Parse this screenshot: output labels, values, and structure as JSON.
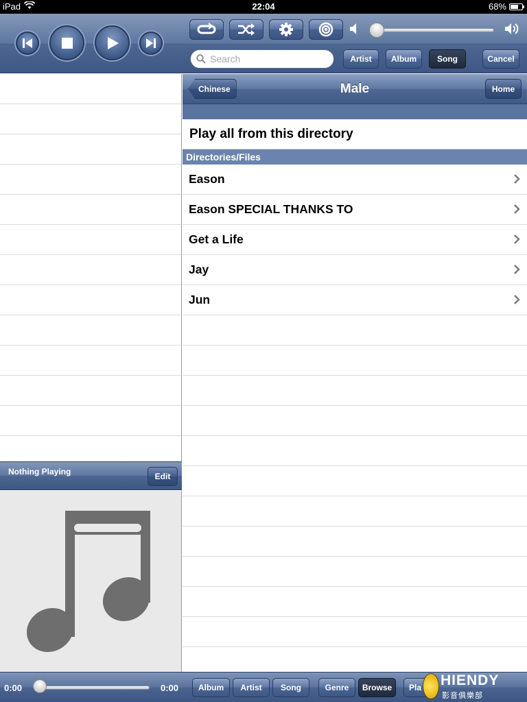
{
  "status_bar": {
    "device": "iPad",
    "time": "22:04",
    "battery": "68%",
    "battery_level": 0.68
  },
  "toolbar": {
    "volume_level": 0.02,
    "search_placeholder": "Search",
    "scopes": [
      {
        "label": "Artist",
        "selected": false
      },
      {
        "label": "Album",
        "selected": false
      },
      {
        "label": "Song",
        "selected": true
      }
    ],
    "cancel_label": "Cancel"
  },
  "left_pane": {
    "now_playing": "Nothing Playing",
    "edit_label": "Edit"
  },
  "browser": {
    "back_label": "Chinese",
    "title": "Male",
    "home_label": "Home",
    "play_all": "Play all from this directory",
    "section_header": "Directories/Files",
    "items": [
      "Eason",
      "Eason SPECIAL THANKS TO",
      "Get a Life",
      "Jay",
      "Jun"
    ]
  },
  "bottom_bar": {
    "elapsed": "0:00",
    "remaining": "0:00",
    "progress": 0,
    "tabs": [
      {
        "label": "Album",
        "selected": false
      },
      {
        "label": "Artist",
        "selected": false
      },
      {
        "label": "Song",
        "selected": false
      },
      {
        "label": "Genre",
        "selected": false
      },
      {
        "label": "Browse",
        "selected": true
      },
      {
        "label": "Pla",
        "selected": false
      }
    ]
  },
  "watermark": {
    "word": "HIENDY",
    "sub": "影音俱樂部"
  },
  "colors": {
    "bar_blue": "#4e6893",
    "section_blue": "#6a84ad",
    "selected_dark": "#1f2a3d"
  }
}
